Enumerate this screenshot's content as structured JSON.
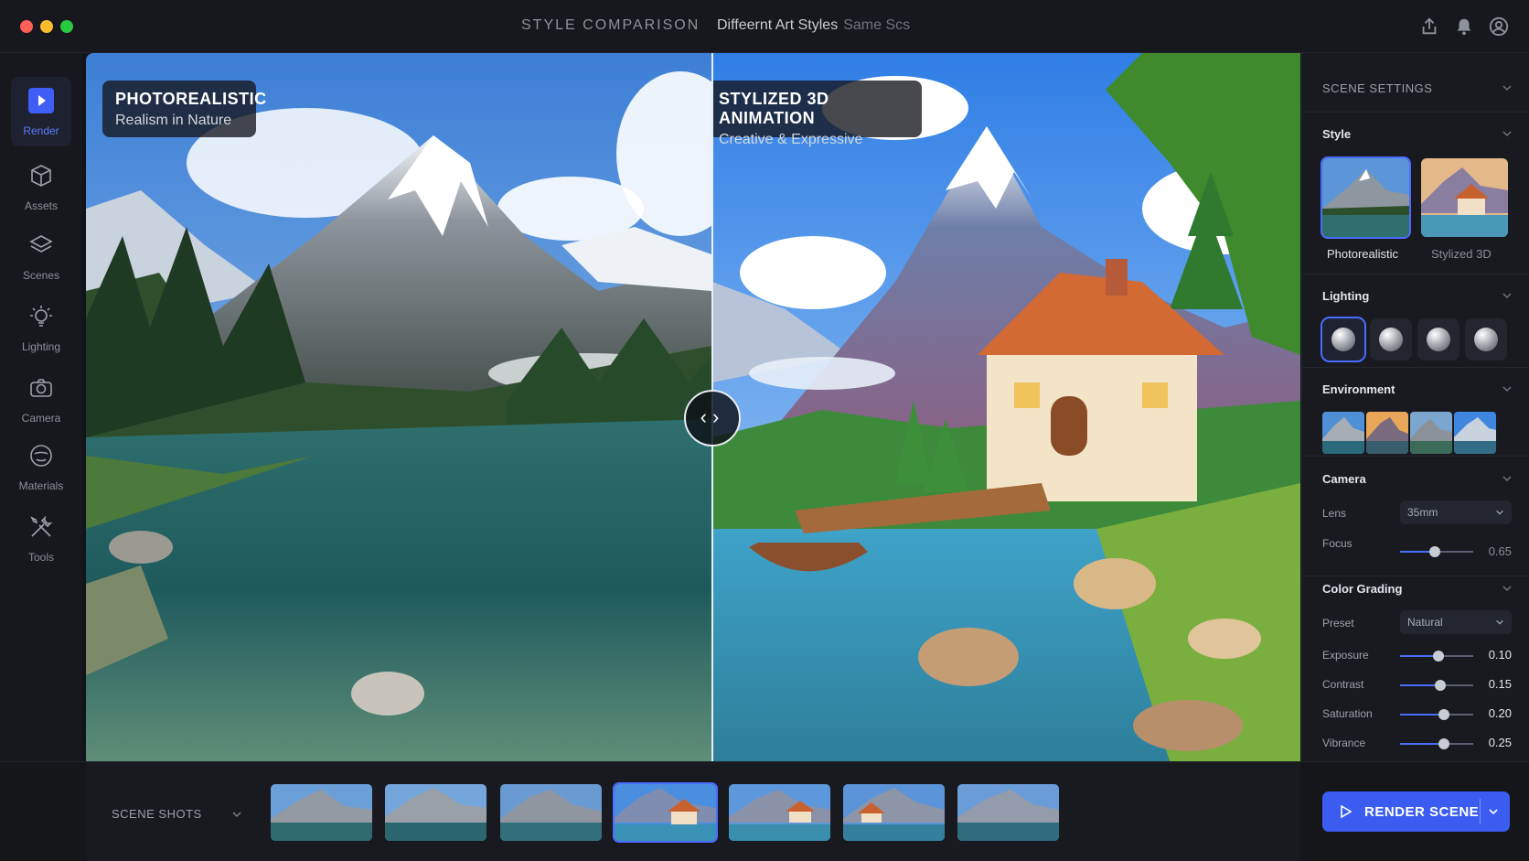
{
  "window": {
    "title": "STYLE COMPARISON",
    "subtitle": "Diffeernt Art Styles",
    "subtitle_extra": "Same Scs"
  },
  "rail": {
    "items": [
      {
        "label": "Render",
        "icon": "render-icon",
        "active": true
      },
      {
        "label": "Assets",
        "icon": "cube-icon"
      },
      {
        "label": "Scenes",
        "icon": "layers-icon"
      },
      {
        "label": "Lighting",
        "icon": "light-bulb-icon"
      },
      {
        "label": "Camera",
        "icon": "camera-icon"
      },
      {
        "label": "Materials",
        "icon": "material-sphere-icon"
      },
      {
        "label": "Tools",
        "icon": "wrench-screwdriver-icon"
      }
    ]
  },
  "viewport": {
    "left": {
      "title": "PHOTOREALISTIC",
      "subtitle": "Realism in Nature"
    },
    "right": {
      "title": "STYLIZED 3D ANIMATION",
      "subtitle": "Creative & Expressive"
    }
  },
  "panel": {
    "header": "SCENE SETTINGS",
    "style": {
      "heading": "Style",
      "options": [
        {
          "label": "Photorealistic",
          "selected": true
        },
        {
          "label": "Stylized 3D",
          "selected": false
        }
      ]
    },
    "lighting": {
      "heading": "Lighting",
      "selected_index": 0,
      "count": 4
    },
    "environment": {
      "heading": "Environment",
      "count": 4
    },
    "camera": {
      "heading": "Camera",
      "lens_label": "Lens",
      "lens_value": "35mm",
      "focus_label": "Focus",
      "focus_value": "0.65"
    },
    "color_grading": {
      "heading": "Color Grading",
      "preset_label": "Preset",
      "preset_value": "Natural",
      "sliders": [
        {
          "label": "Exposure",
          "value": "0.10"
        },
        {
          "label": "Contrast",
          "value": "0.15"
        },
        {
          "label": "Saturation",
          "value": "0.20"
        },
        {
          "label": "Vibrance",
          "value": "0.25"
        }
      ]
    }
  },
  "bottom": {
    "shots_label": "SCENE SHOTS",
    "shot_count": 7,
    "selected_shot": 3,
    "render_button": "RENDER SCENE"
  },
  "colors": {
    "accent": "#3a5cf0",
    "background": "#121419",
    "panel": "#181a20"
  }
}
